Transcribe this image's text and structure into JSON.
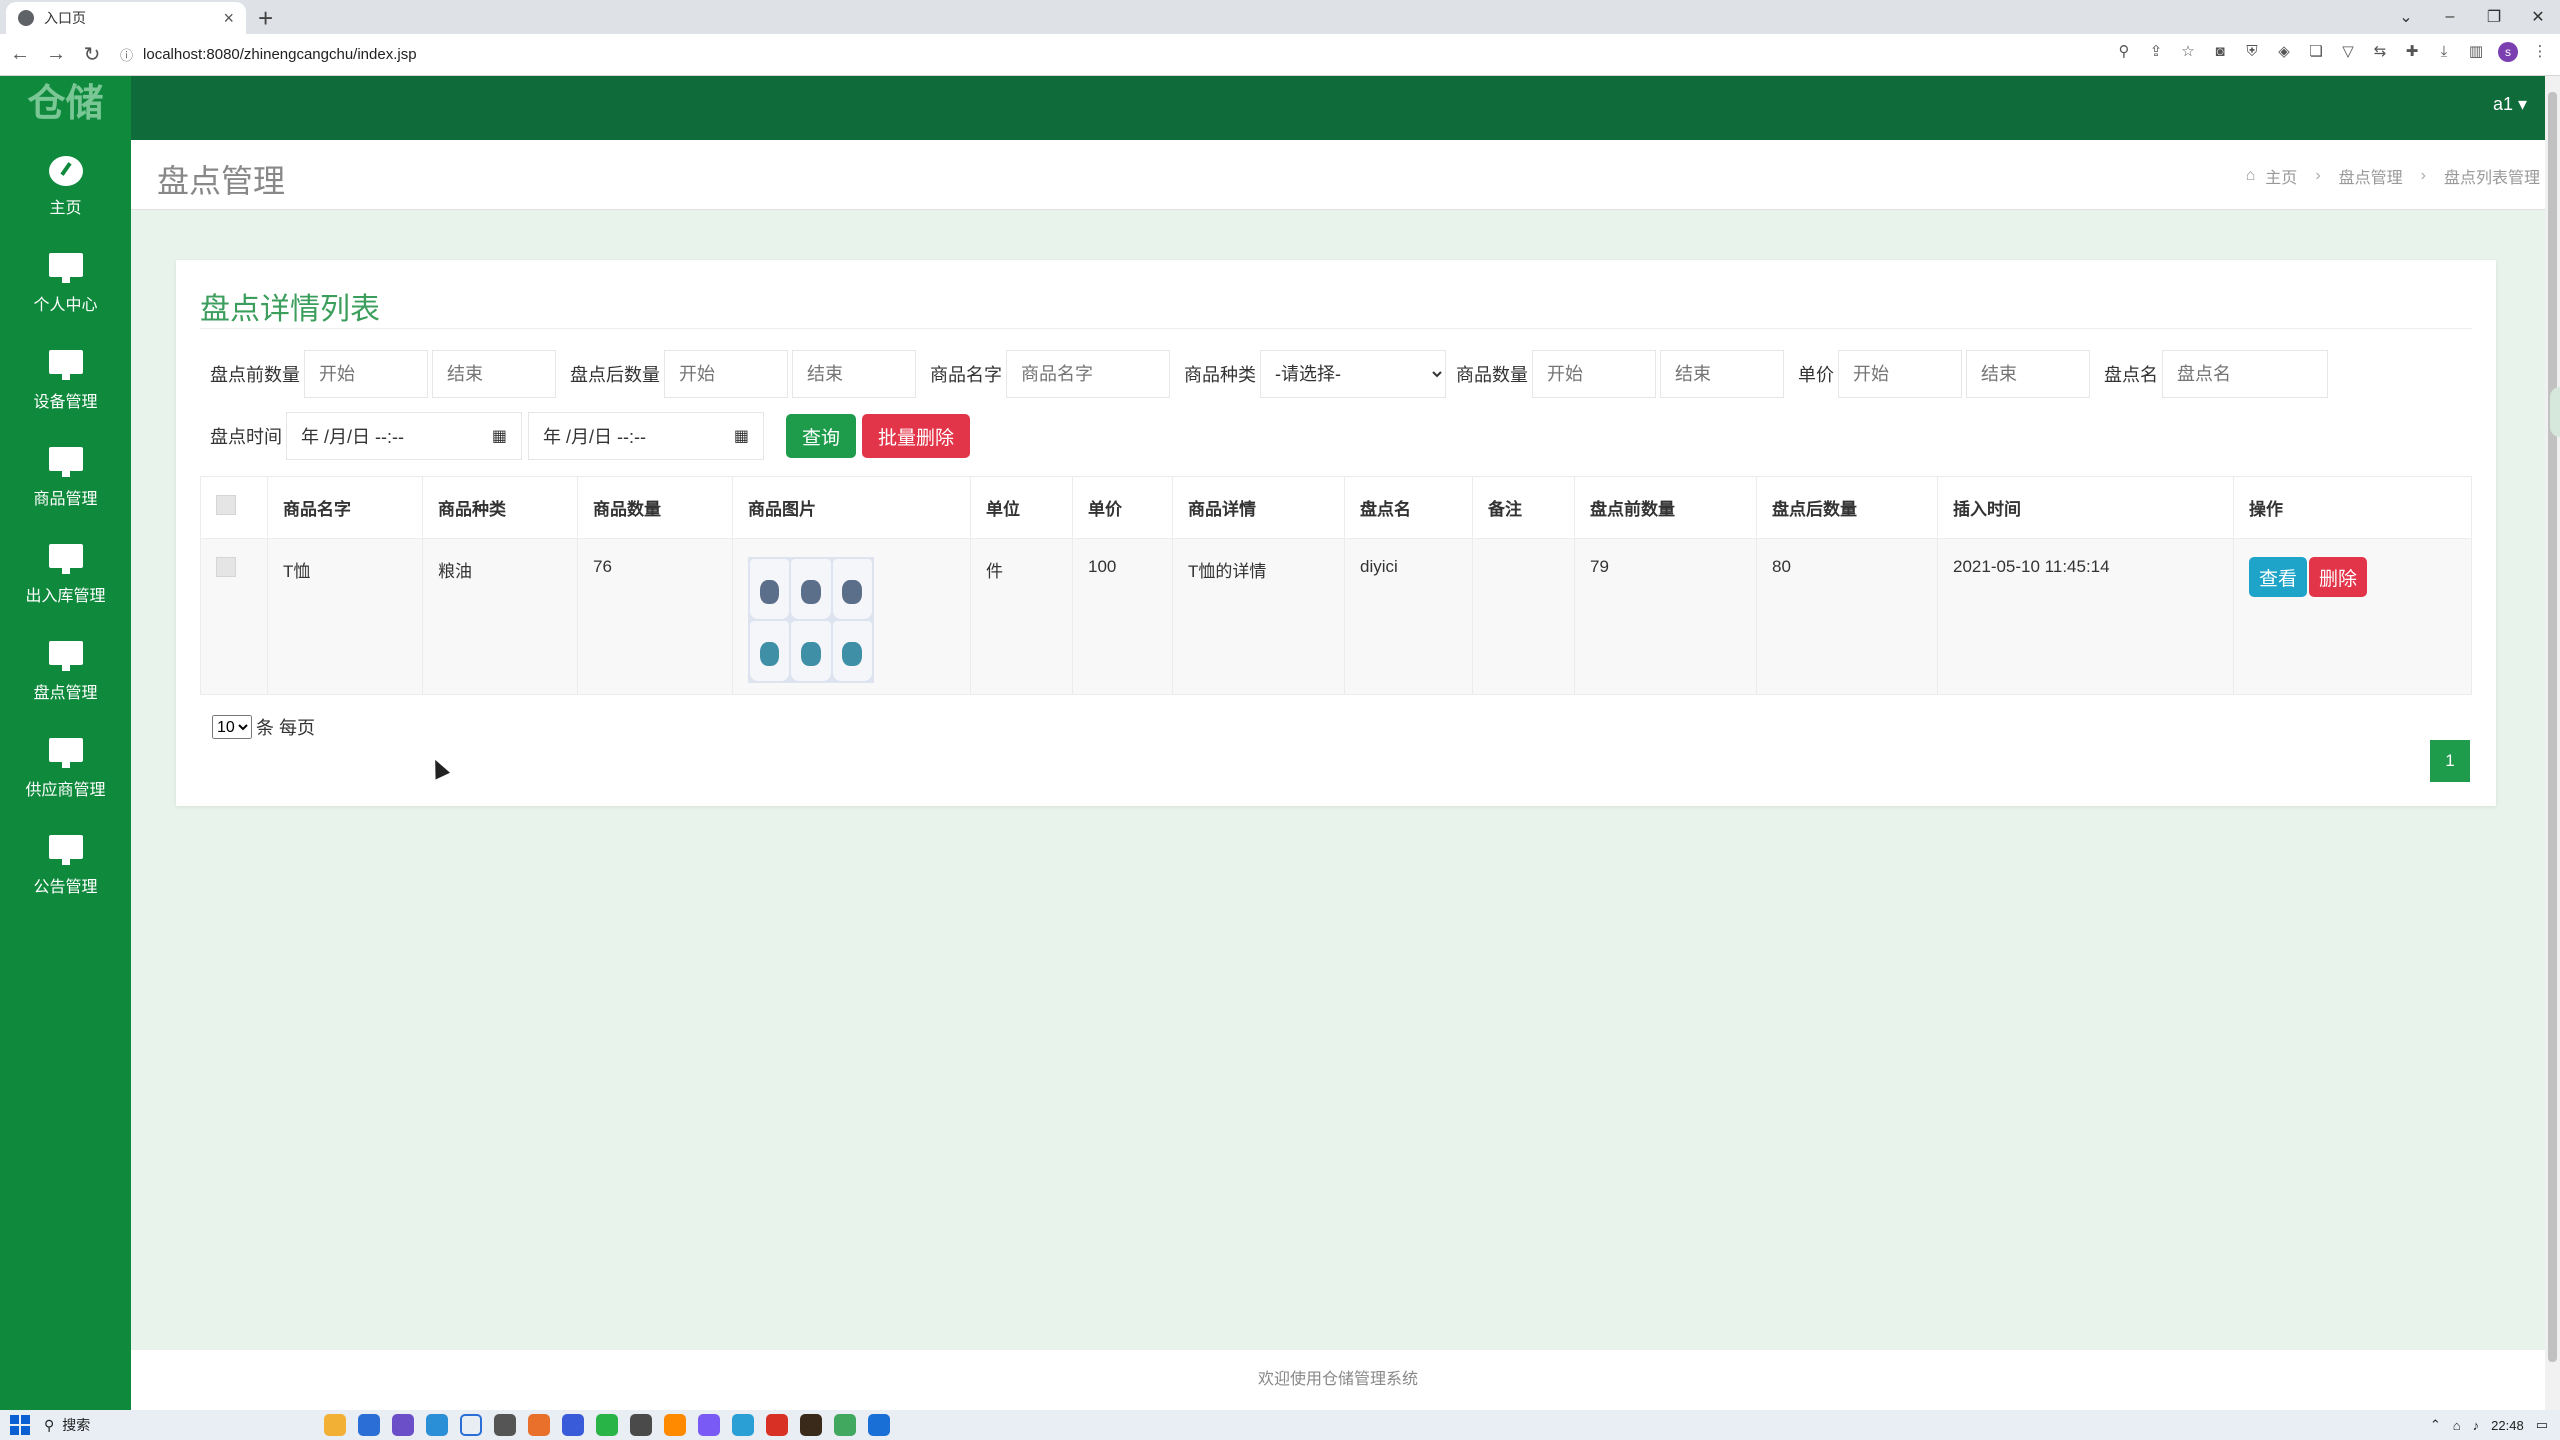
{
  "browser": {
    "tab_title": "入口页",
    "url": "localhost:8080/zhinengcangchu/index.jsp",
    "new_tab": "+"
  },
  "app": {
    "logo": "仓储",
    "user": "a1 ▾"
  },
  "sidebar": {
    "items": [
      {
        "label": "主页",
        "icon": "dashboard-icon"
      },
      {
        "label": "个人中心",
        "icon": "monitor-icon"
      },
      {
        "label": "设备管理",
        "icon": "monitor-icon"
      },
      {
        "label": "商品管理",
        "icon": "monitor-icon"
      },
      {
        "label": "出入库管理",
        "icon": "monitor-icon"
      },
      {
        "label": "盘点管理",
        "icon": "monitor-icon"
      },
      {
        "label": "供应商管理",
        "icon": "monitor-icon"
      },
      {
        "label": "公告管理",
        "icon": "monitor-icon"
      }
    ]
  },
  "page": {
    "title": "盘点管理",
    "breadcrumb": [
      "主页",
      "盘点管理",
      "盘点列表管理"
    ]
  },
  "card": {
    "title": "盘点详情列表"
  },
  "filters": {
    "before_qty_label": "盘点前数量",
    "after_qty_label": "盘点后数量",
    "goods_name_label": "商品名字",
    "goods_type_label": "商品种类",
    "goods_qty_label": "商品数量",
    "price_label": "单价",
    "check_name_label": "盘点名",
    "time_label": "盘点时间",
    "start_placeholder": "开始",
    "end_placeholder": "结束",
    "goods_name_placeholder": "商品名字",
    "check_name_placeholder": "盘点名",
    "type_selected": "-请选择-",
    "date_placeholder": "年 /月/日 --:--",
    "query_button": "查询",
    "batch_delete_button": "批量删除"
  },
  "table": {
    "headers": [
      "商品名字",
      "商品种类",
      "商品数量",
      "商品图片",
      "单位",
      "单价",
      "商品详情",
      "盘点名",
      "备注",
      "盘点前数量",
      "盘点后数量",
      "插入时间",
      "操作"
    ],
    "rows": [
      {
        "name": "T恤",
        "type": "粮油",
        "qty": "76",
        "unit": "件",
        "price": "100",
        "detail": "T恤的详情",
        "check_name": "diyici",
        "remark": "",
        "before": "79",
        "after": "80",
        "time": "2021-05-10 11:45:14",
        "view": "查看",
        "delete": "删除"
      }
    ]
  },
  "pagination": {
    "page_size": "10",
    "per_page_label": "条 每页",
    "current_page": "1"
  },
  "footer": {
    "text": "欢迎使用仓储管理系统"
  },
  "taskbar": {
    "search": "搜索",
    "clock": "22:48"
  },
  "colors": {
    "sidebar": "#0f8a3d",
    "topbar": "#0f6b3a",
    "accent": "#1e9c4c",
    "danger": "#e3354a",
    "info": "#1ea4c9"
  }
}
